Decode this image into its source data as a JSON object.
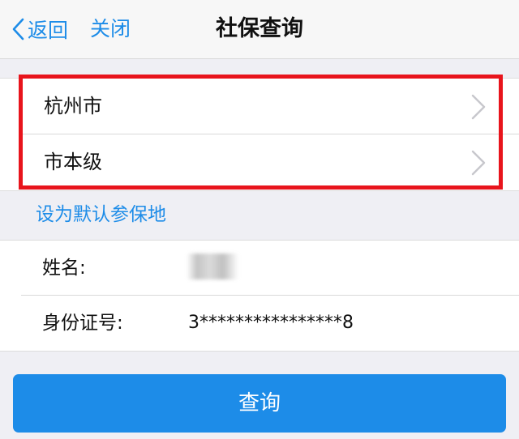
{
  "nav": {
    "back_label": "返回",
    "close_label": "关闭",
    "title": "社保查询"
  },
  "region": {
    "city": "杭州市",
    "level": "市本级"
  },
  "default_link": "设为默认参保地",
  "form": {
    "name_label": "姓名:",
    "name_value": "",
    "id_label": "身份证号:",
    "id_value": "3****************8"
  },
  "query_button": "查询",
  "colors": {
    "accent": "#1d8ce8",
    "highlight": "#e8141c",
    "background": "#efeff4"
  }
}
